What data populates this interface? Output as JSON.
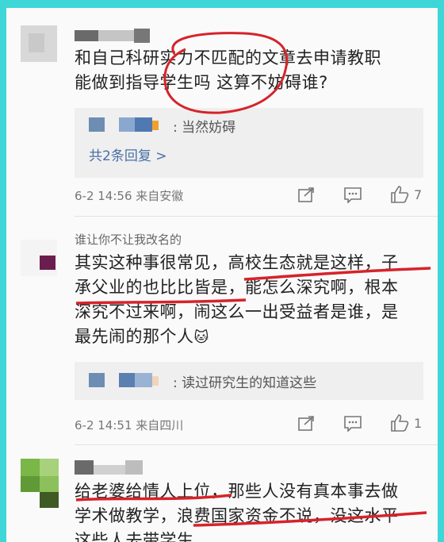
{
  "comments": [
    {
      "text_lines": [
        "和自己科研实力不匹配的文章去申请教职",
        "能做到指导学生吗 这算不妨碍谁?"
      ],
      "reply": {
        "text": ": 当然妨碍",
        "count_label": "共2条回复 >"
      },
      "meta": "6-2 14:56 来自安徽",
      "likes": "7"
    },
    {
      "username": "谁让你不让我改名的",
      "text_lines": [
        "其实这种事很常见，高校生态就是这样，子",
        "承父业的也比比皆是，能怎么深究啊，根本",
        "深究不过来啊，闹这么一出受益者是谁，是",
        "最先闹的那个人"
      ],
      "emoji": "🐱",
      "reply": {
        "text": ": 读过研究生的知道这些"
      },
      "meta": "6-2 14:51 来自四川",
      "likes": "1"
    },
    {
      "text_lines": [
        "给老婆给情人上位，那些人没有真本事去做",
        "学术做教学，浪费国家资金不说，没这水平",
        "这些人去带学生"
      ]
    }
  ],
  "icons": {
    "share": "share-icon",
    "comment": "comment-icon",
    "like": "thumbs-up-icon"
  },
  "colors": {
    "frame": "#3fd6d8",
    "annotation": "#d6232a",
    "link": "#4a6fa5"
  }
}
